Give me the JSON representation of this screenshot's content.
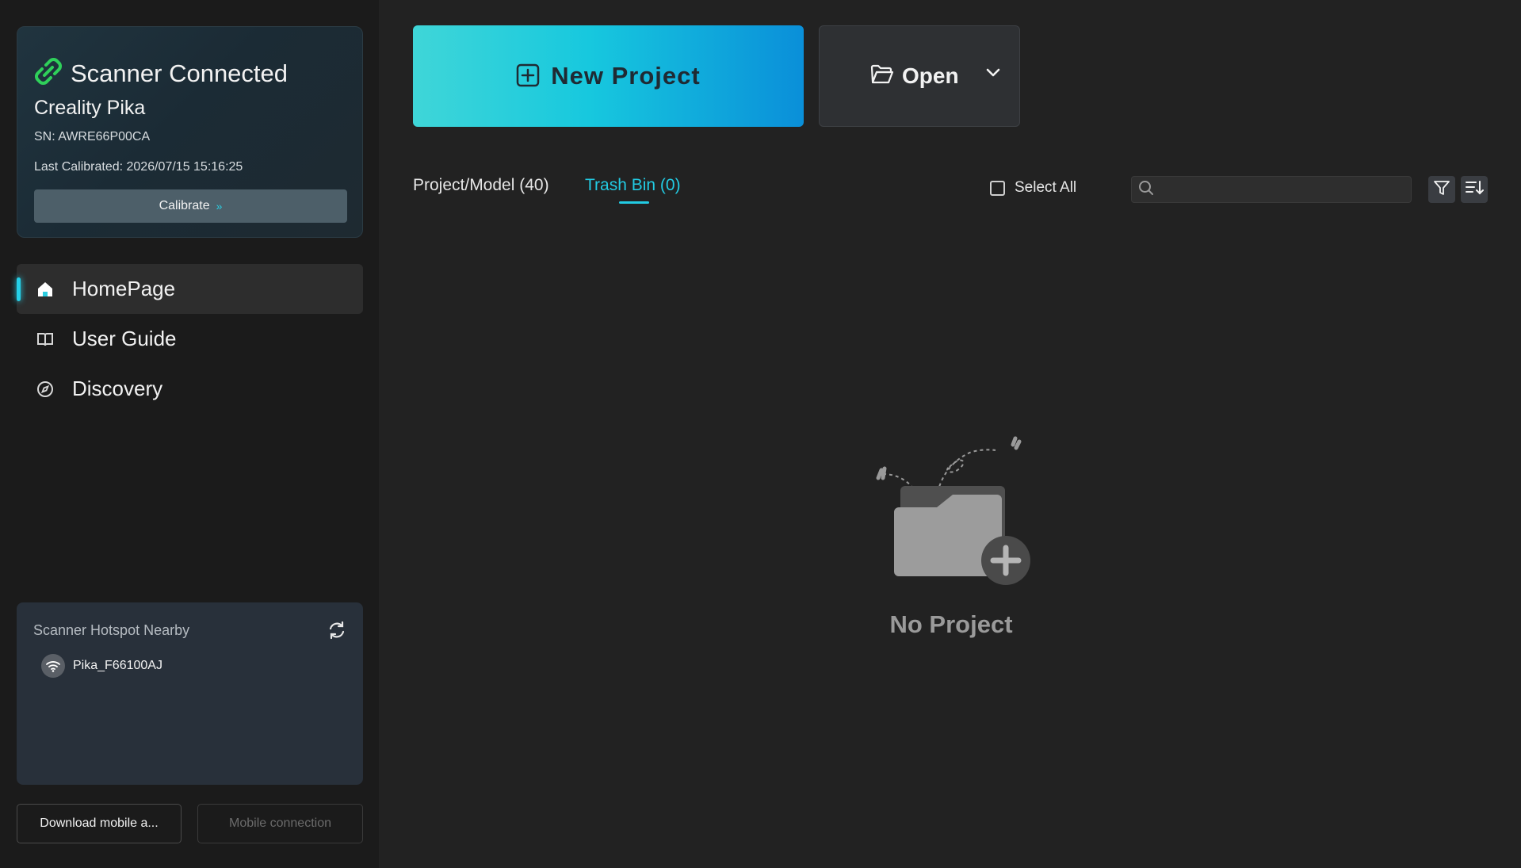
{
  "scanner": {
    "status": "Scanner Connected",
    "model": "Creality Pika",
    "sn": "SN: AWRE66P00CA",
    "last_calibrated": "Last Calibrated: 2026/07/15 15:16:25",
    "calibrate_label": "Calibrate",
    "status_color": "#2fd05a"
  },
  "nav": {
    "items": [
      {
        "label": "HomePage",
        "icon": "home-icon",
        "active": true
      },
      {
        "label": "User Guide",
        "icon": "book-icon",
        "active": false
      },
      {
        "label": "Discovery",
        "icon": "compass-icon",
        "active": false
      }
    ]
  },
  "hotspot": {
    "title": "Scanner Hotspot Nearby",
    "items": [
      {
        "name": "Pika_F66100AJ",
        "icon": "wifi-icon"
      }
    ]
  },
  "footer": {
    "download_label": "Download mobile a...",
    "mobile_label": "Mobile connection"
  },
  "main": {
    "new_project_label": "New Project",
    "open_label": "Open",
    "tabs": [
      {
        "label": "Project/Model (40)",
        "active": false
      },
      {
        "label": "Trash Bin (0)",
        "active": true
      }
    ],
    "select_all_label": "Select All",
    "search_value": "",
    "empty_text": "No Project"
  },
  "colors": {
    "accent": "#22cbe3",
    "background": "#222222",
    "sidebar": "#1b1b1b"
  }
}
